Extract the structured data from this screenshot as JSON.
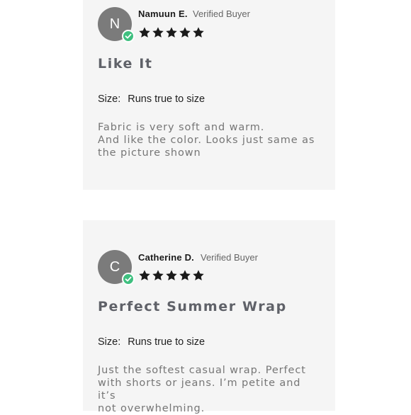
{
  "reviews": [
    {
      "avatar_initial": "N",
      "name": "Namuun E.",
      "verified_label": "Verified Buyer",
      "rating": 5,
      "title": "Like It",
      "size_label": "Size:",
      "size_value": "Runs true to size",
      "body": "Fabric is very soft and warm.\nAnd like the color. Looks just same as\nthe picture shown"
    },
    {
      "avatar_initial": "C",
      "name": "Catherine D.",
      "verified_label": "Verified Buyer",
      "rating": 5,
      "title": "Perfect Summer Wrap",
      "size_label": "Size:",
      "size_value": "Runs true to size",
      "body": "Just the softest casual wrap. Perfect\nwith shorts or jeans. I’m petite and it’s\nnot overwhelming."
    }
  ],
  "colors": {
    "avatar_bg": "#7b7b7b",
    "verified_badge": "#3fbf7f",
    "star": "#1a1a1a",
    "card_bg": "#f5f5f5",
    "page_bg": "#ffffff"
  },
  "icons": {
    "verified": "check-circle-icon",
    "rating": "star-icon"
  }
}
